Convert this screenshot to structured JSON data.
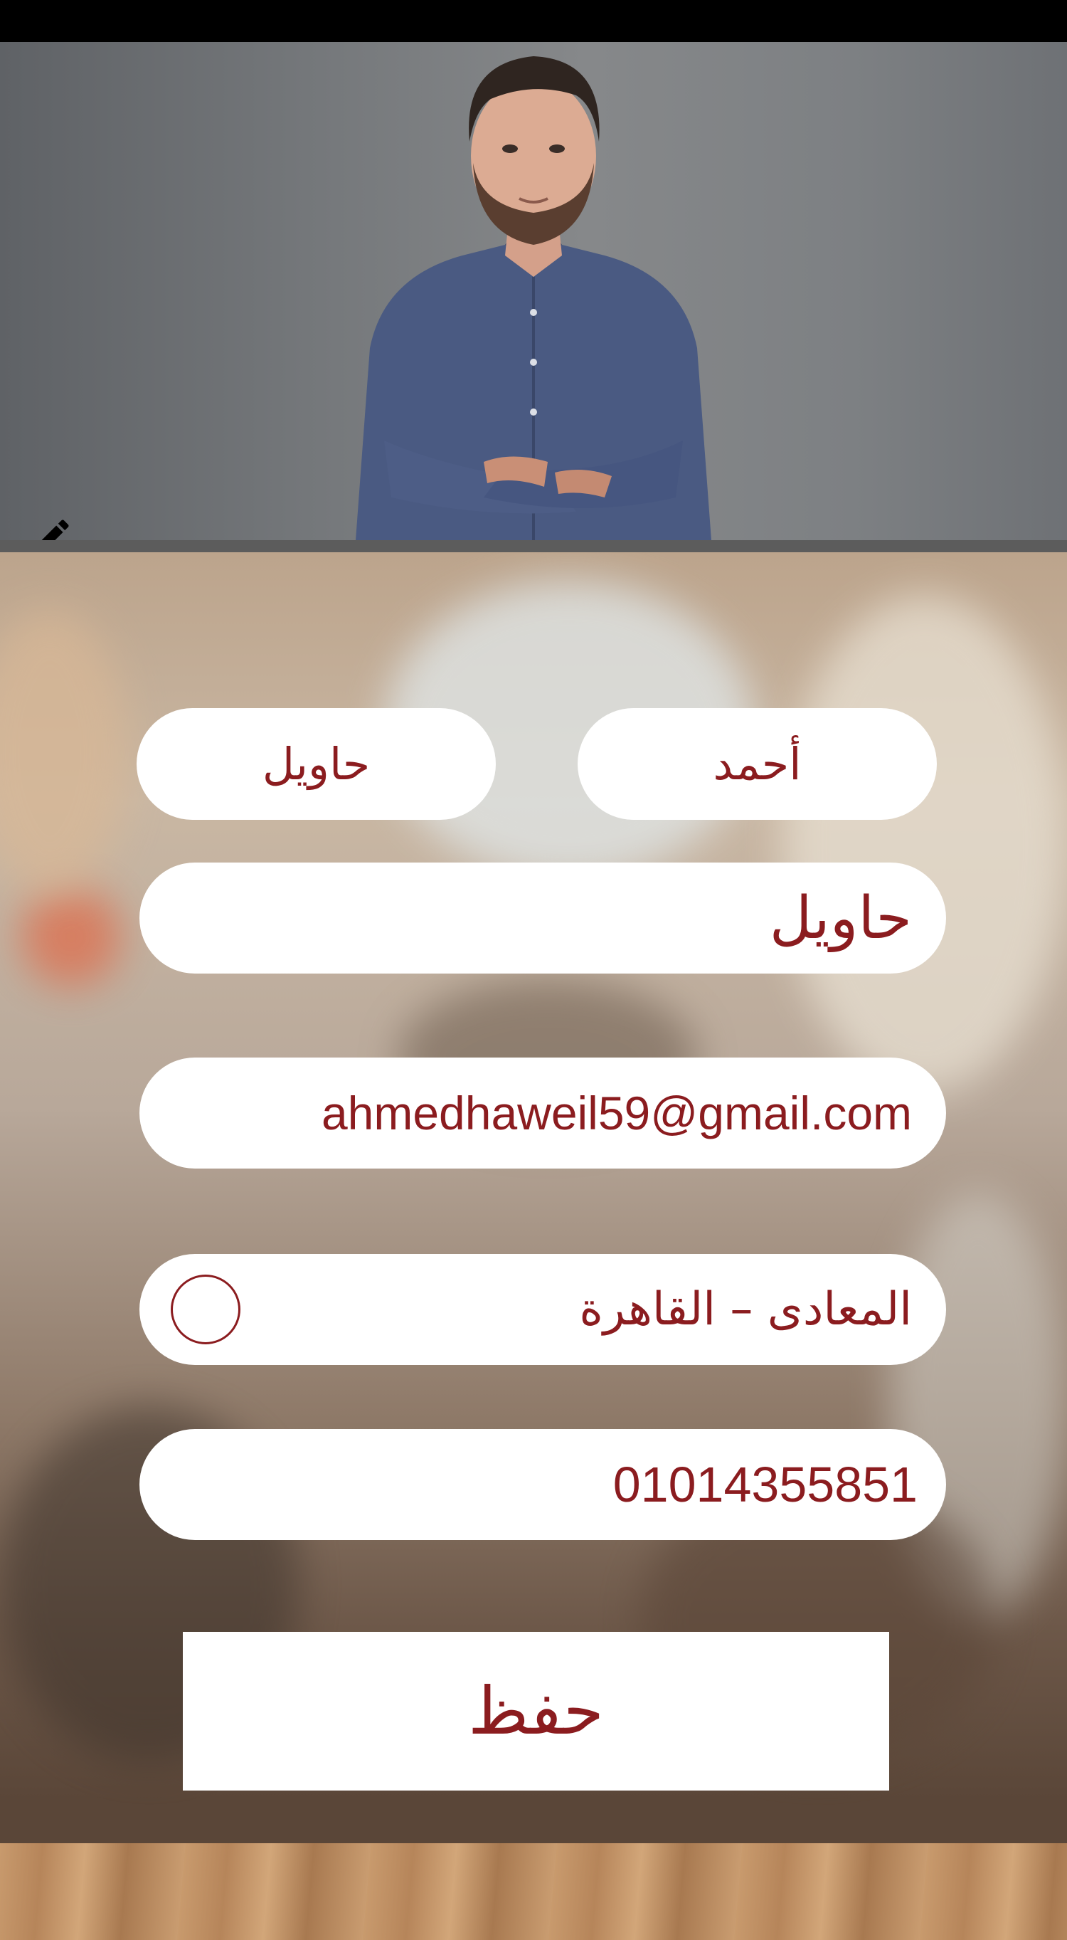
{
  "status_bar": {},
  "profile": {
    "edit_icon": "pencil-icon",
    "photo_description_icon": "person-photo"
  },
  "form": {
    "first_name": "أحمد",
    "last_name": "حاويل",
    "display_name": "حاويل",
    "email": "ahmedhaweil59@gmail.com",
    "address": "المعادى – القاهرة",
    "phone": "01014355851",
    "save_label": "حفظ"
  },
  "colors": {
    "accent": "#8b1c1f",
    "field_bg": "#ffffff",
    "status_bar": "#000000"
  }
}
